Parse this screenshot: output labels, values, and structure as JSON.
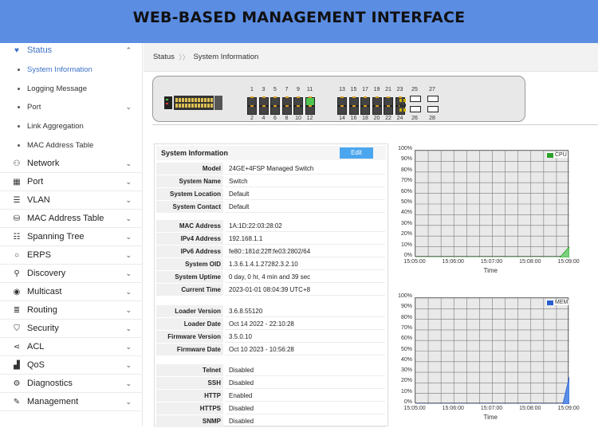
{
  "banner": {
    "title": "WEB-BASED MANAGEMENT INTERFACE"
  },
  "sidebar": {
    "status": {
      "label": "Status",
      "icon": "heart-pulse-icon",
      "chevron": "⌃"
    },
    "sub_items": [
      {
        "label": "System Information",
        "active": true,
        "has_chevron": false
      },
      {
        "label": "Logging Message",
        "active": false,
        "has_chevron": false
      },
      {
        "label": "Port",
        "active": false,
        "has_chevron": true
      },
      {
        "label": "Link Aggregation",
        "active": false,
        "has_chevron": false
      },
      {
        "label": "MAC Address Table",
        "active": false,
        "has_chevron": false
      }
    ],
    "items": [
      {
        "label": "Network",
        "icon": "network-icon",
        "glyph": "⚇"
      },
      {
        "label": "Port",
        "icon": "port-icon",
        "glyph": "▦"
      },
      {
        "label": "VLAN",
        "icon": "vlan-icon",
        "glyph": "☰"
      },
      {
        "label": "MAC Address Table",
        "icon": "database-icon",
        "glyph": "⛁"
      },
      {
        "label": "Spanning Tree",
        "icon": "sliders-icon",
        "glyph": "☷"
      },
      {
        "label": "ERPS",
        "icon": "ring-icon",
        "glyph": "○"
      },
      {
        "label": "Discovery",
        "icon": "search-icon",
        "glyph": "⚲"
      },
      {
        "label": "Multicast",
        "icon": "multicast-icon",
        "glyph": "◉"
      },
      {
        "label": "Routing",
        "icon": "routing-icon",
        "glyph": "≣"
      },
      {
        "label": "Security",
        "icon": "shield-icon",
        "glyph": "⛉"
      },
      {
        "label": "ACL",
        "icon": "share-icon",
        "glyph": "⋖"
      },
      {
        "label": "QoS",
        "icon": "qos-chart-icon",
        "glyph": "▟"
      },
      {
        "label": "Diagnostics",
        "icon": "gear-icon",
        "glyph": "⚙"
      },
      {
        "label": "Management",
        "icon": "wrench-icon",
        "glyph": "✎"
      }
    ],
    "chevron": "⌄"
  },
  "breadcrumb": {
    "root": "Status",
    "sep": "〉〉",
    "current": "System Information"
  },
  "device": {
    "top_ports": [
      "1",
      "3",
      "5",
      "7",
      "9",
      "11",
      "13",
      "15",
      "17",
      "19",
      "21",
      "23"
    ],
    "bottom_ports": [
      "2",
      "4",
      "6",
      "8",
      "10",
      "12",
      "14",
      "16",
      "18",
      "20",
      "22",
      "24"
    ],
    "sfp_top": [
      "25",
      "27"
    ],
    "sfp_bottom": [
      "26",
      "28"
    ],
    "up_port": "11"
  },
  "system_info": {
    "title": "System Information",
    "edit_label": "Edit",
    "groups": [
      [
        {
          "key": "Model",
          "value": "24GE+4FSP Managed Switch"
        },
        {
          "key": "System Name",
          "value": "Switch"
        },
        {
          "key": "System Location",
          "value": "Default"
        },
        {
          "key": "System Contact",
          "value": "Default"
        }
      ],
      [
        {
          "key": "MAC Address",
          "value": "1A:1D:22:03:28:02"
        },
        {
          "key": "IPv4 Address",
          "value": "192.168.1.1"
        },
        {
          "key": "IPv6 Address",
          "value": "fe80::181d:22ff:fe03:2802/64"
        },
        {
          "key": "System OID",
          "value": "1.3.6.1.4.1.27282.3.2.10"
        },
        {
          "key": "System Uptime",
          "value": "0 day, 0 hr, 4 min and 39 sec"
        },
        {
          "key": "Current Time",
          "value": "2023-01-01 08:04:39 UTC+8"
        }
      ],
      [
        {
          "key": "Loader Version",
          "value": "3.6.8.55120"
        },
        {
          "key": "Loader Date",
          "value": "Oct 14 2022 - 22:10:28"
        },
        {
          "key": "Firmware Version",
          "value": "3.5.0.10"
        },
        {
          "key": "Firmware Date",
          "value": "Oct 10 2023 - 10:56:28"
        }
      ],
      [
        {
          "key": "Telnet",
          "value": "Disabled"
        },
        {
          "key": "SSH",
          "value": "Disabled"
        },
        {
          "key": "HTTP",
          "value": "Enabled"
        },
        {
          "key": "HTTPS",
          "value": "Disabled"
        },
        {
          "key": "SNMP",
          "value": "Disabled"
        }
      ]
    ]
  },
  "chart_data": [
    {
      "type": "area",
      "series": [
        {
          "name": "CPU",
          "color": "#2aa22a",
          "fill": "#7dd17d",
          "x": [
            "15:05:00",
            "15:06:00",
            "15:07:00",
            "15:08:00",
            "15:08:45",
            "15:09:00"
          ],
          "values": [
            0,
            0,
            0,
            0,
            0,
            10
          ]
        }
      ],
      "x_ticks": [
        "15:05:00",
        "15:06:00",
        "15:07:00",
        "15:08:00",
        "15:09:00"
      ],
      "y_ticks": [
        "0%",
        "10%",
        "20%",
        "30%",
        "40%",
        "50%",
        "60%",
        "70%",
        "80%",
        "90%",
        "100%"
      ],
      "ylim": [
        0,
        100
      ],
      "xlabel": "Time",
      "grid": true,
      "legend": "top-right"
    },
    {
      "type": "area",
      "series": [
        {
          "name": "MEM",
          "color": "#2a5fcf",
          "fill": "#5b8ee8",
          "x": [
            "15:05:00",
            "15:06:00",
            "15:07:00",
            "15:08:00",
            "15:08:50",
            "15:09:00"
          ],
          "values": [
            0,
            0,
            0,
            0,
            0,
            26
          ]
        }
      ],
      "x_ticks": [
        "15:05:00",
        "15:06:00",
        "15:07:00",
        "15:08:00",
        "15:09:00"
      ],
      "y_ticks": [
        "0%",
        "10%",
        "20%",
        "30%",
        "40%",
        "50%",
        "60%",
        "70%",
        "80%",
        "90%",
        "100%"
      ],
      "ylim": [
        0,
        100
      ],
      "xlabel": "Time",
      "grid": true,
      "legend": "top-right"
    }
  ]
}
